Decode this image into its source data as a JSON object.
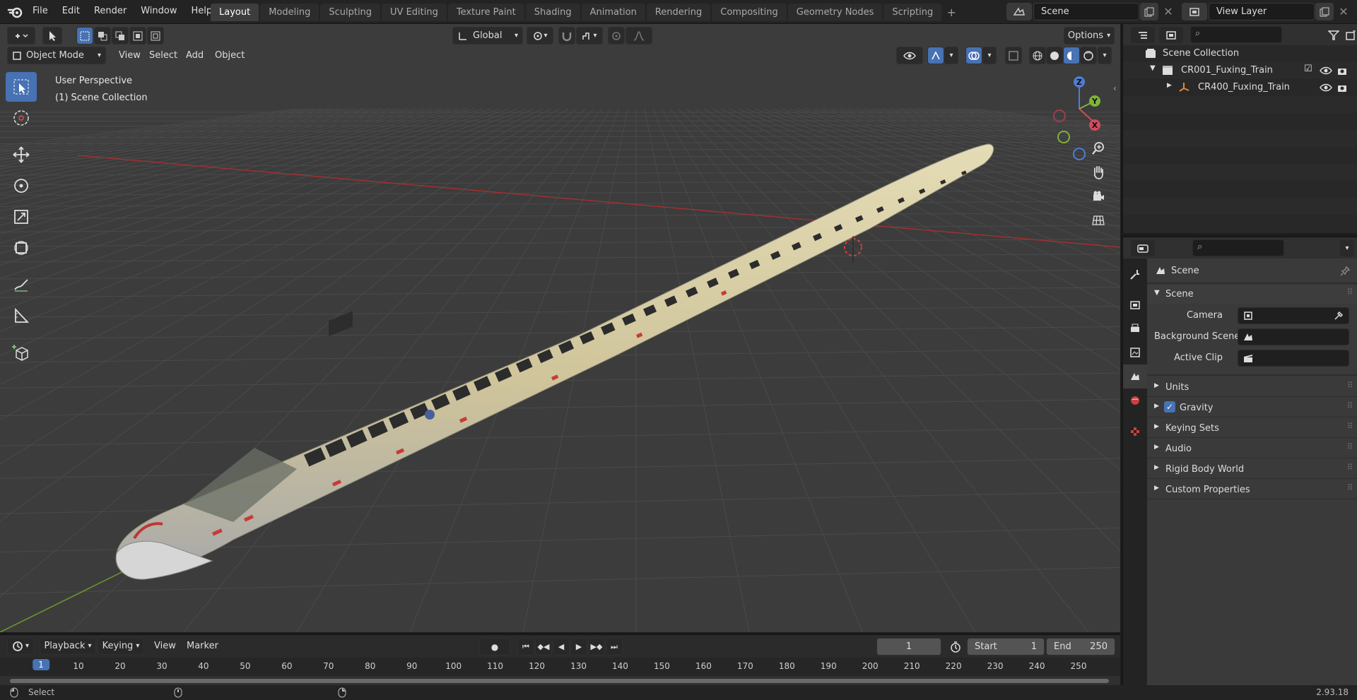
{
  "topbar": {
    "menu": [
      "File",
      "Edit",
      "Render",
      "Window",
      "Help"
    ],
    "workspaces": [
      "Layout",
      "Modeling",
      "Sculpting",
      "UV Editing",
      "Texture Paint",
      "Shading",
      "Animation",
      "Rendering",
      "Compositing",
      "Geometry Nodes",
      "Scripting"
    ],
    "active_workspace": "Layout",
    "add_workspace": "+",
    "scene": "Scene",
    "view_layer": "View Layer"
  },
  "viewport": {
    "transform_orientation": "Global",
    "options_label": "Options",
    "mode": "Object Mode",
    "header_menu": [
      "View",
      "Select",
      "Add",
      "Object"
    ],
    "overlay_line1": "User Perspective",
    "overlay_line2": "(1) Scene Collection",
    "gizmo": {
      "z": "Z",
      "y": "Y",
      "x": "X"
    }
  },
  "outliner": {
    "root": "Scene Collection",
    "collection": "CR001_Fuxing_Train",
    "object": "CR400_Fuxing_Train"
  },
  "properties": {
    "header_title": "Scene",
    "panel_title": "Scene",
    "fields": [
      {
        "label": "Camera"
      },
      {
        "label": "Background Scene"
      },
      {
        "label": "Active Clip"
      }
    ],
    "sections": [
      "Units",
      "Gravity",
      "Keying Sets",
      "Audio",
      "Rigid Body World",
      "Custom Properties"
    ],
    "gravity_checked": true
  },
  "timeline": {
    "menu": [
      "Playback",
      "Keying",
      "View",
      "Marker"
    ],
    "current_frame": "1",
    "start_label": "Start",
    "start": "1",
    "end_label": "End",
    "end": "250",
    "ruler": [
      "1",
      "10",
      "20",
      "30",
      "40",
      "50",
      "60",
      "70",
      "80",
      "90",
      "100",
      "110",
      "120",
      "130",
      "140",
      "150",
      "160",
      "170",
      "180",
      "190",
      "200",
      "210",
      "220",
      "230",
      "240",
      "250"
    ]
  },
  "statusbar": {
    "action": "Select",
    "version": "2.93.18"
  },
  "colors": {
    "accent": "#4772b3",
    "train_body": "#cfc49a",
    "axis_x": "#a03030",
    "axis_y": "#6a9a2a"
  }
}
